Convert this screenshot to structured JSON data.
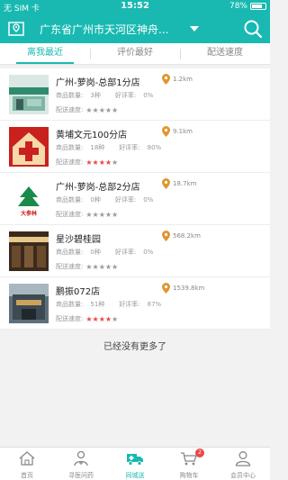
{
  "status_bar": {
    "carrier": "无 SIM 卡",
    "time": "15:52",
    "battery": "78%",
    "battery_level": 0.78
  },
  "header": {
    "location": "广东省广州市天河区神舟..."
  },
  "tabs": [
    {
      "label": "离我最近",
      "active": true
    },
    {
      "label": "评价最好",
      "active": false
    },
    {
      "label": "配送速度",
      "active": false
    }
  ],
  "store_labels": {
    "goods_count": "商品数量:",
    "rating": "好评率:",
    "speed": "配送速度:"
  },
  "stores": [
    {
      "name": "广州-萝岗-总部1分店",
      "goods": "3种",
      "rating": "0%",
      "stars": 0,
      "distance": "1.2km",
      "thumb_icon": "storefront-photo"
    },
    {
      "name": "黄埔文元100分店",
      "goods": "18种",
      "rating": "80%",
      "stars": 4,
      "distance": "9.1km",
      "thumb_icon": "red-cross-logo"
    },
    {
      "name": "广州-萝岗-总部2分店",
      "goods": "0种",
      "rating": "0%",
      "stars": 0,
      "distance": "18.7km",
      "thumb_icon": "daxiangle-logo",
      "thumb_caption": "大参林"
    },
    {
      "name": "星沙碧桂园",
      "goods": "0种",
      "rating": "0%",
      "stars": 0,
      "distance": "568.2km",
      "thumb_icon": "interior-photo"
    },
    {
      "name": "鹏振072店",
      "goods": "51种",
      "rating": "87%",
      "stars": 4,
      "distance": "1539.8km",
      "thumb_icon": "building-photo"
    }
  ],
  "no_more_text": "已经没有更多了",
  "tab_bar": [
    {
      "label": "首页",
      "icon": "home-icon",
      "active": false
    },
    {
      "label": "寻医问药",
      "icon": "doctor-icon",
      "active": false
    },
    {
      "label": "同城送",
      "icon": "delivery-truck-icon",
      "active": true
    },
    {
      "label": "购物车",
      "icon": "cart-icon",
      "active": false,
      "badge": "2"
    },
    {
      "label": "会员中心",
      "icon": "user-icon",
      "active": false
    }
  ],
  "colors": {
    "accent": "#19b9b2",
    "star_on": "#e84848",
    "star_off": "#9a9a9a",
    "badge": "#e84848"
  }
}
